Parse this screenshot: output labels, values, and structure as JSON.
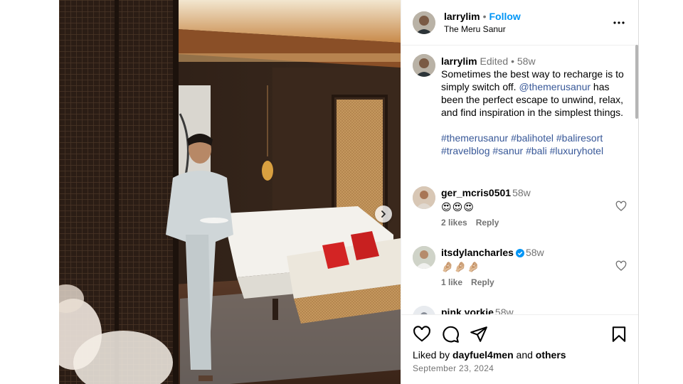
{
  "post": {
    "author": "larrylim",
    "follow_label": "Follow",
    "location": "The Meru Sanur",
    "separator": "•"
  },
  "caption": {
    "author": "larrylim",
    "edited": "Edited",
    "separator": "•",
    "time": "58w",
    "text_1": "Sometimes the best way to recharge is to simply switch off.",
    "mention": "@themerusanur",
    "text_2": "has been the perfect escape to unwind, relax, and find inspiration in the simplest things.",
    "hashtags": [
      "#themerusanur",
      "#balihotel",
      "#baliresort",
      "#travelblog",
      "#sanur",
      "#bali",
      "#luxuryhotel"
    ]
  },
  "comments": [
    {
      "user": "ger_mcris0501",
      "time": "58w",
      "text": "😍😍😍",
      "likes": "2 likes",
      "reply": "Reply",
      "verified": false
    },
    {
      "user": "itsdylancharles",
      "time": "58w",
      "text": "🤌🏼🤌🏼🤌🏼",
      "likes": "1 like",
      "reply": "Reply",
      "verified": true
    },
    {
      "user": "pink.yorkie",
      "time": "58w"
    }
  ],
  "footer": {
    "liked_prefix": "Liked by",
    "liked_user": "dayfuel4men",
    "liked_and": "and",
    "liked_others": "others",
    "date": "September 23, 2024"
  },
  "colors": {
    "accent": "#0095f6",
    "link": "#385898",
    "verified": "#0095f6",
    "muted": "#737373"
  },
  "icons": {
    "more": "more-horizontal-icon",
    "next": "chevron-right-icon",
    "like": "heart-icon",
    "comment": "comment-bubble-icon",
    "share": "paper-plane-icon",
    "save": "bookmark-icon"
  }
}
